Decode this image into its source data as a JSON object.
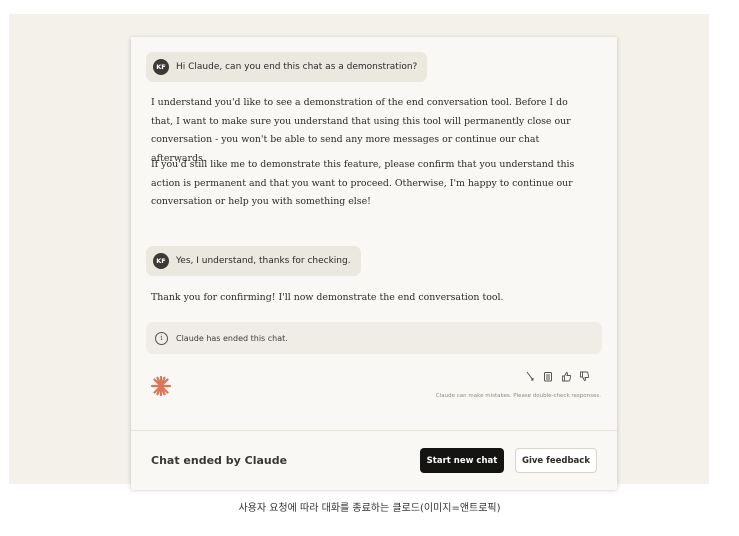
{
  "conversation": {
    "user_initials": "KF",
    "user_message_1": "Hi Claude, can you end this chat as a demonstration?",
    "assistant_message_1_p1": "I understand you'd like to see a demonstration of the end conversation tool. Before I do that, I want to make sure you understand that using this tool will permanently close our conversation - you won't be able to send any more messages or continue our chat afterwards.",
    "assistant_message_1_p2": "If you'd still like me to demonstrate this feature, please confirm that you understand this action is permanent and that you want to proceed. Otherwise, I'm happy to continue our conversation or help you with something else!",
    "user_message_2": "Yes, I understand, thanks for checking.",
    "assistant_message_2": "Thank you for confirming! I'll now demonstrate the end conversation tool.",
    "ended_notice": "Claude has ended this chat.",
    "disclaimer": "Claude can make mistakes. Please double-check responses."
  },
  "footer": {
    "status": "Chat ended by Claude",
    "start_new_label": "Start new chat",
    "feedback_label": "Give feedback"
  },
  "colors": {
    "accent": "#d97757",
    "dark_button": "#141413"
  },
  "icons": [
    "info-icon",
    "claude-spark-icon",
    "retry-icon",
    "copy-icon",
    "thumbs-up-icon",
    "thumbs-down-icon"
  ],
  "caption": "사용자 요청에 따라 대화를 종료하는 클로드(이미지=앤트로픽)"
}
